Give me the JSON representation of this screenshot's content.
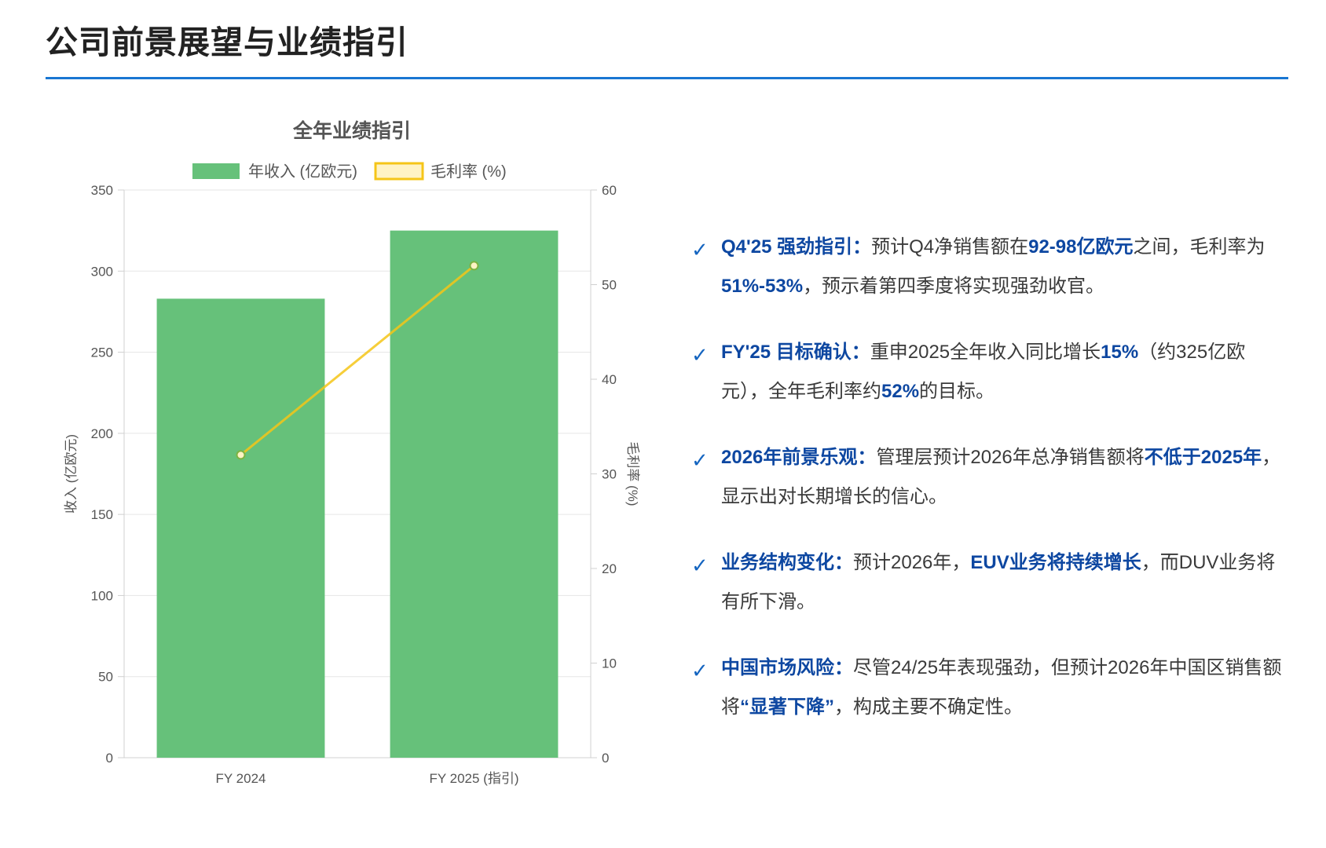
{
  "page": {
    "title": "公司前景展望与业绩指引"
  },
  "chart_data": {
    "type": "bar",
    "title": "全年业绩指引",
    "categories": [
      "FY 2024",
      "FY 2025 (指引)"
    ],
    "series": [
      {
        "name": "年收入 (亿欧元)",
        "type": "bar",
        "axis": "left",
        "values": [
          283,
          325
        ],
        "color": "#66c17a"
      },
      {
        "name": "毛利率 (%)",
        "type": "line",
        "axis": "right",
        "values": [
          32,
          52
        ],
        "color": "#f5c518"
      }
    ],
    "y_left": {
      "label": "收入 (亿欧元)",
      "min": 0,
      "max": 350,
      "ticks": [
        0,
        50,
        100,
        150,
        200,
        250,
        300,
        350
      ]
    },
    "y_right": {
      "label": "毛利率 (%)",
      "min": 0,
      "max": 60,
      "ticks": [
        0,
        10,
        20,
        30,
        40,
        50,
        60
      ]
    },
    "grid": true,
    "legend_position": "top"
  },
  "points": [
    {
      "parts": [
        {
          "text": "Q4'25 强劲指引：",
          "hl": true
        },
        {
          "text": "预计Q4净销售额在",
          "hl": false
        },
        {
          "text": "92-98亿欧元",
          "hl": true
        },
        {
          "text": "之间，毛利率为",
          "hl": false
        },
        {
          "text": "51%-53%",
          "hl": true
        },
        {
          "text": "，预示着第四季度将实现强劲收官。",
          "hl": false
        }
      ]
    },
    {
      "parts": [
        {
          "text": "FY'25 目标确认：",
          "hl": true
        },
        {
          "text": "重申2025全年收入同比增长",
          "hl": false
        },
        {
          "text": "15%",
          "hl": true
        },
        {
          "text": "（约325亿欧元），全年毛利率约",
          "hl": false
        },
        {
          "text": "52%",
          "hl": true
        },
        {
          "text": "的目标。",
          "hl": false
        }
      ]
    },
    {
      "parts": [
        {
          "text": "2026年前景乐观：",
          "hl": true
        },
        {
          "text": "管理层预计2026年总净销售额将",
          "hl": false
        },
        {
          "text": "不低于2025年",
          "hl": true
        },
        {
          "text": "，显示出对长期增长的信心。",
          "hl": false
        }
      ]
    },
    {
      "parts": [
        {
          "text": "业务结构变化：",
          "hl": true
        },
        {
          "text": "预计2026年，",
          "hl": false
        },
        {
          "text": "EUV业务将持续增长",
          "hl": true
        },
        {
          "text": "，而DUV业务将有所下滑。",
          "hl": false
        }
      ]
    },
    {
      "parts": [
        {
          "text": "中国市场风险：",
          "hl": true
        },
        {
          "text": "尽管24/25年表现强劲，但预计2026年中国区销售额将",
          "hl": false
        },
        {
          "text": "“显著下降”",
          "hl": true
        },
        {
          "text": "，构成主要不确定性。",
          "hl": false
        }
      ]
    }
  ],
  "check_glyph": "✓"
}
